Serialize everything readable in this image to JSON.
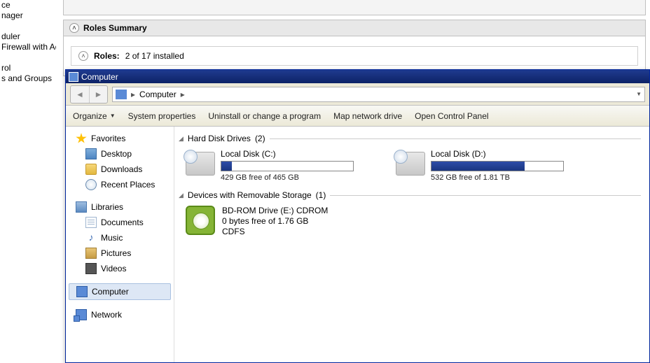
{
  "bg": {
    "tree_items": [
      "ce",
      "nager",
      "",
      "duler",
      "Firewall with Adva",
      "",
      "rol",
      "s and Groups"
    ],
    "roles_summary": "Roles Summary",
    "roles_label": "Roles:",
    "roles_value": "2 of 17 installed"
  },
  "explorer": {
    "title": "Computer",
    "address": {
      "segment": "Computer"
    },
    "toolbar": {
      "organize": "Organize",
      "system_properties": "System properties",
      "uninstall": "Uninstall or change a program",
      "map_drive": "Map network drive",
      "control_panel": "Open Control Panel"
    },
    "sidebar": {
      "favorites": "Favorites",
      "desktop": "Desktop",
      "downloads": "Downloads",
      "recent": "Recent Places",
      "libraries": "Libraries",
      "documents": "Documents",
      "music": "Music",
      "pictures": "Pictures",
      "videos": "Videos",
      "computer": "Computer",
      "network": "Network"
    },
    "sections": {
      "hdd": {
        "title": "Hard Disk Drives",
        "count": "(2)"
      },
      "rem": {
        "title": "Devices with Removable Storage",
        "count": "(1)"
      }
    },
    "drives": {
      "c": {
        "label": "Local Disk (C:)",
        "free": "429 GB free of 465 GB",
        "used_pct": 8
      },
      "d": {
        "label": "Local Disk (D:)",
        "free": "532 GB free of 1.81 TB",
        "used_pct": 71
      }
    },
    "removable": {
      "e": {
        "label": "BD-ROM Drive (E:) CDROM",
        "free": "0 bytes free of 1.76 GB",
        "fs": "CDFS"
      }
    }
  }
}
